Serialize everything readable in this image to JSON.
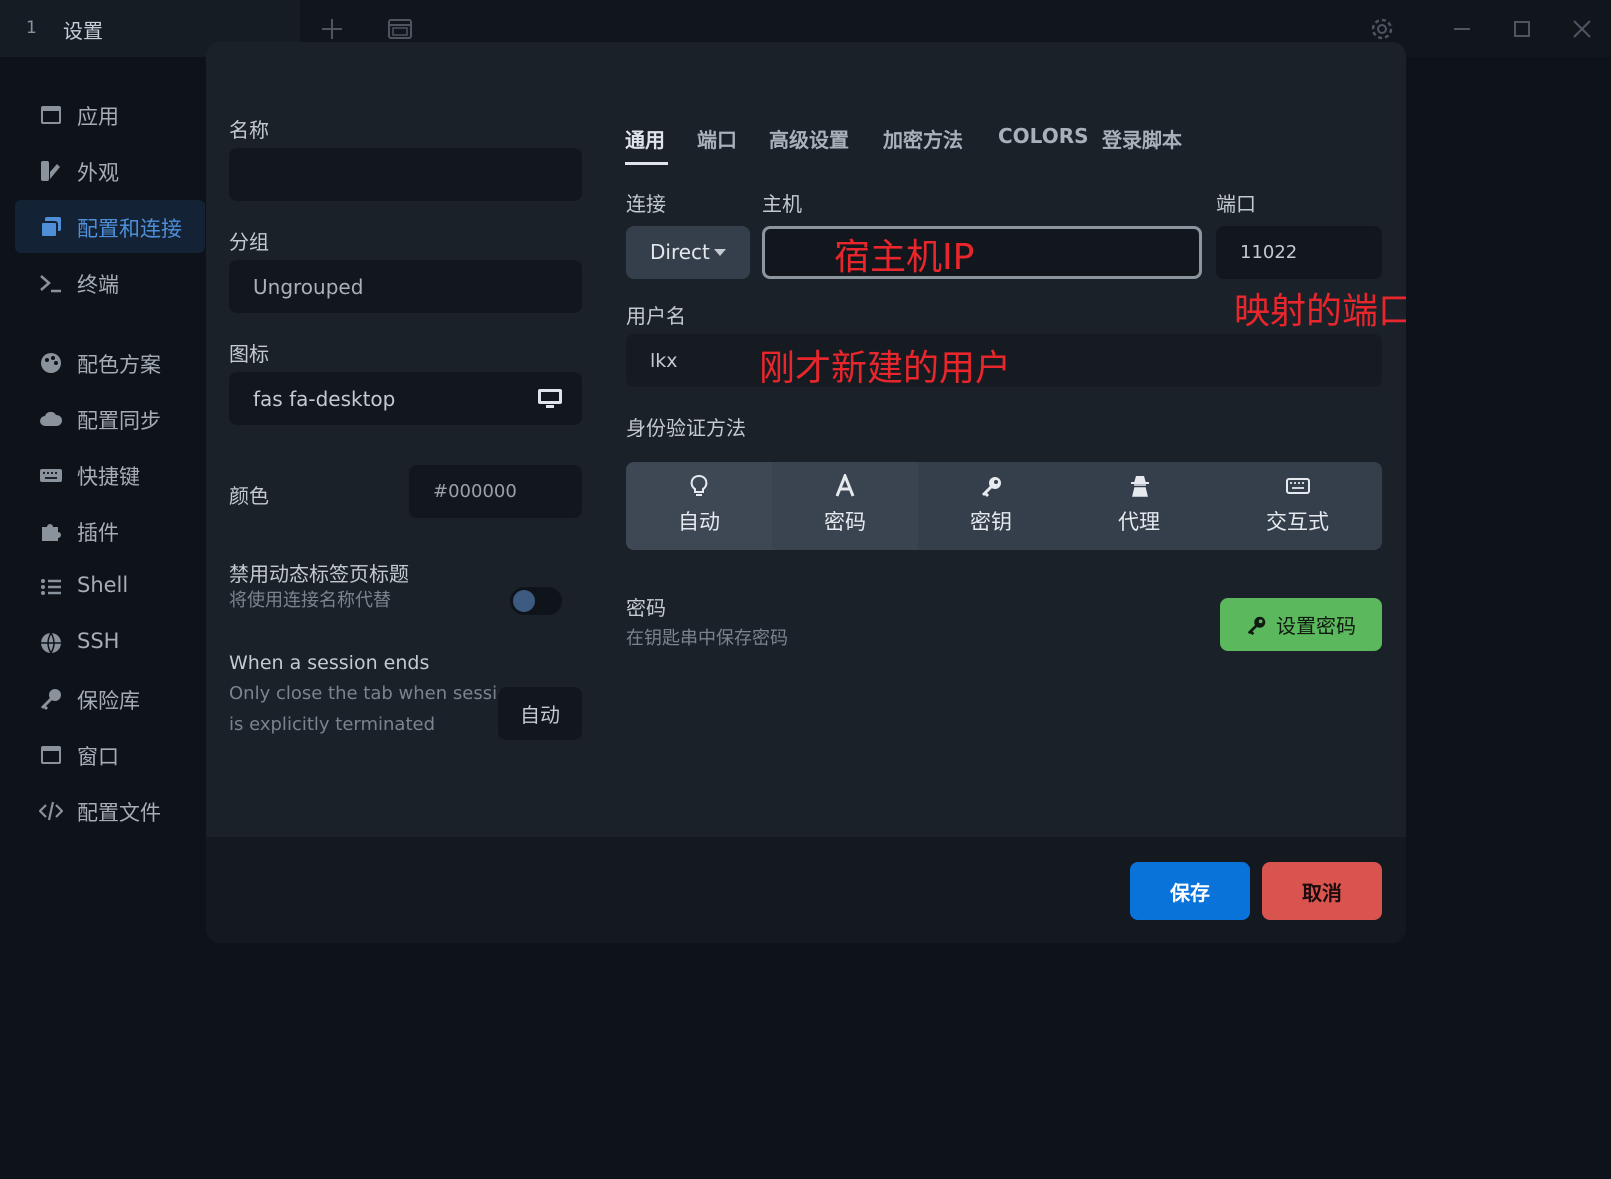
{
  "titlebar": {
    "tab_number": "1",
    "tab_title": "设置",
    "icons": [
      "plus-icon",
      "new-window-icon",
      "gear-icon",
      "minimize-icon",
      "maximize-icon",
      "close-icon"
    ]
  },
  "sidebar": {
    "items": [
      {
        "label": "应用",
        "icon": "window-icon"
      },
      {
        "label": "外观",
        "icon": "paint-icon"
      },
      {
        "label": "配置和连接",
        "icon": "profiles-icon",
        "active": true
      },
      {
        "label": "终端",
        "icon": "terminal-icon"
      },
      {
        "label": "配色方案",
        "icon": "palette-icon"
      },
      {
        "label": "配置同步",
        "icon": "cloud-icon"
      },
      {
        "label": "快捷键",
        "icon": "keyboard-icon"
      },
      {
        "label": "插件",
        "icon": "puzzle-icon"
      },
      {
        "label": "Shell",
        "icon": "list-icon"
      },
      {
        "label": "SSH",
        "icon": "globe-icon"
      },
      {
        "label": "保险库",
        "icon": "key-icon"
      },
      {
        "label": "窗口",
        "icon": "window-icon"
      },
      {
        "label": "配置文件",
        "icon": "code-icon"
      }
    ]
  },
  "left": {
    "name_label": "名称",
    "name_value": "",
    "group_label": "分组",
    "group_value": "Ungrouped",
    "icon_label": "图标",
    "icon_value": "fas fa-desktop",
    "color_label": "颜色",
    "color_value": "#000000",
    "disable_title_label": "禁用动态标签页标题",
    "disable_title_sub": "将使用连接名称代替",
    "session_label": "When a session ends",
    "session_sub_1": "Only close the tab when session",
    "session_sub_2": "is explicitly terminated",
    "session_value": "自动"
  },
  "tabs": [
    "通用",
    "端口",
    "高级设置",
    "加密方法",
    "COLORS",
    "登录脚本"
  ],
  "connection": {
    "connect_label": "连接",
    "connect_value": "Direct",
    "host_label": "主机",
    "host_value": "",
    "port_label": "端口",
    "port_value": "11022",
    "username_label": "用户名",
    "username_value": "lkx",
    "auth_label": "身份验证方法",
    "auth_options": [
      {
        "label": "自动",
        "icon": "lightbulb-icon"
      },
      {
        "label": "密码",
        "icon": "font-a-icon"
      },
      {
        "label": "密钥",
        "icon": "key-icon"
      },
      {
        "label": "代理",
        "icon": "agent-icon"
      },
      {
        "label": "交互式",
        "icon": "keyboard-icon"
      }
    ],
    "password_label": "密码",
    "password_sub": "在钥匙串中保存密码",
    "set_password_button": "设置密码"
  },
  "annotations": {
    "host": "宿主机IP",
    "port": "映射的端口",
    "user": "刚才新建的用户"
  },
  "footer": {
    "save": "保存",
    "cancel": "取消"
  },
  "colors": {
    "accent_blue": "#0a73d9",
    "danger_red": "#d9534f",
    "success_green": "#5cb85c",
    "annotation_red": "#e8262b"
  }
}
